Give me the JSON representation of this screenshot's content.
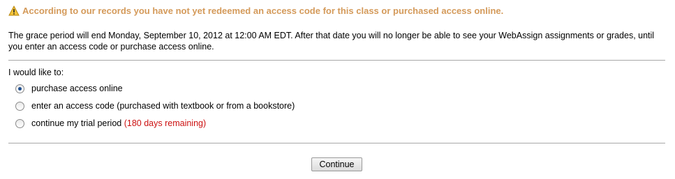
{
  "warning": {
    "icon": "warning-triangle-icon",
    "text": "According to our records you have not yet redeemed an access code for this class or purchased access online.",
    "color": "#d49a5a"
  },
  "grace": {
    "text": "The grace period will end Monday, September 10, 2012 at 12:00 AM EDT. After that date you will no longer be able to see your WebAssign assignments or grades, until you enter an access code or purchase access online."
  },
  "form": {
    "prompt": "I would like to:",
    "options": [
      {
        "label": "purchase access online",
        "selected": true
      },
      {
        "label": "enter an access code (purchased with textbook or from a bookstore)",
        "selected": false
      },
      {
        "label": "continue my trial period",
        "extra": "(180 days remaining)",
        "extra_color": "#cc1111",
        "selected": false
      }
    ],
    "continue_label": "Continue"
  }
}
